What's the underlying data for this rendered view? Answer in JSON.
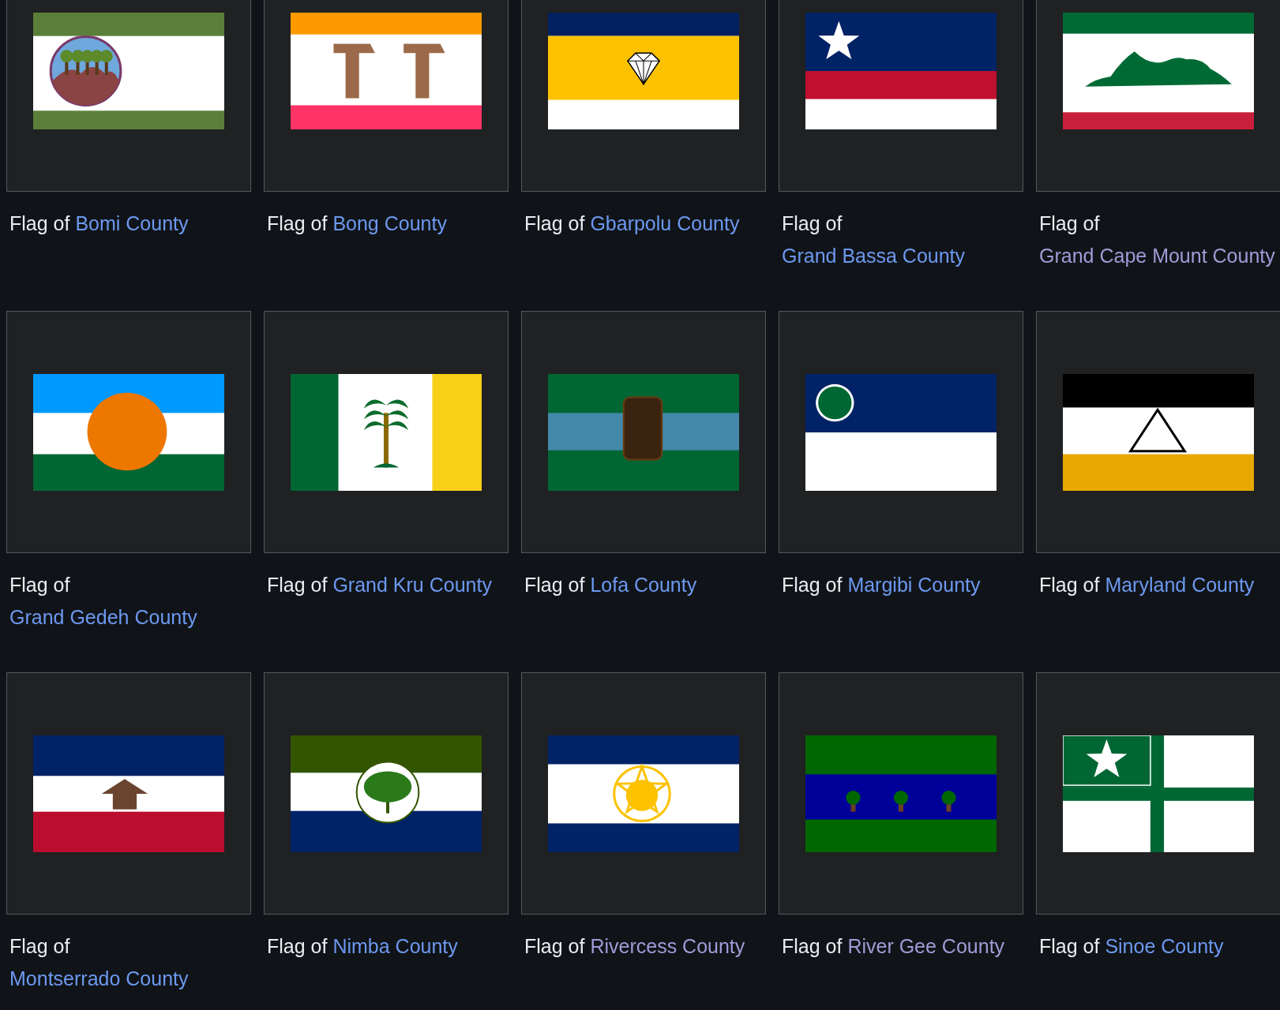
{
  "gallery": [
    {
      "prefix": "Flag of",
      "link": "Bomi County",
      "visited": false,
      "kind": "bomi"
    },
    {
      "prefix": "Flag of",
      "link": "Bong County",
      "visited": false,
      "kind": "bong"
    },
    {
      "prefix": "Flag of",
      "link": "Gbarpolu County",
      "visited": false,
      "kind": "gbarpolu"
    },
    {
      "prefix": "Flag of",
      "link": "Grand Bassa County",
      "visited": false,
      "kind": "grandbassa"
    },
    {
      "prefix": "Flag of",
      "link": "Grand Cape Mount County",
      "visited": true,
      "kind": "grandcape"
    },
    {
      "prefix": "Flag of",
      "link": "Grand Gedeh County",
      "visited": false,
      "kind": "grandgedeh"
    },
    {
      "prefix": "Flag of",
      "link": "Grand Kru County",
      "visited": false,
      "kind": "grandkru"
    },
    {
      "prefix": "Flag of",
      "link": "Lofa County",
      "visited": false,
      "kind": "lofa"
    },
    {
      "prefix": "Flag of",
      "link": "Margibi County",
      "visited": false,
      "kind": "margibi"
    },
    {
      "prefix": "Flag of",
      "link": "Maryland County",
      "visited": false,
      "kind": "maryland"
    },
    {
      "prefix": "Flag of",
      "link": "Montserrado County",
      "visited": false,
      "kind": "montserrado"
    },
    {
      "prefix": "Flag of",
      "link": "Nimba County",
      "visited": false,
      "kind": "nimba"
    },
    {
      "prefix": "Flag of",
      "link": "Rivercess County",
      "visited": true,
      "kind": "rivercess"
    },
    {
      "prefix": "Flag of",
      "link": "River Gee County",
      "visited": true,
      "kind": "rivergee"
    },
    {
      "prefix": "Flag of",
      "link": "Sinoe County",
      "visited": false,
      "kind": "sinoe"
    }
  ]
}
